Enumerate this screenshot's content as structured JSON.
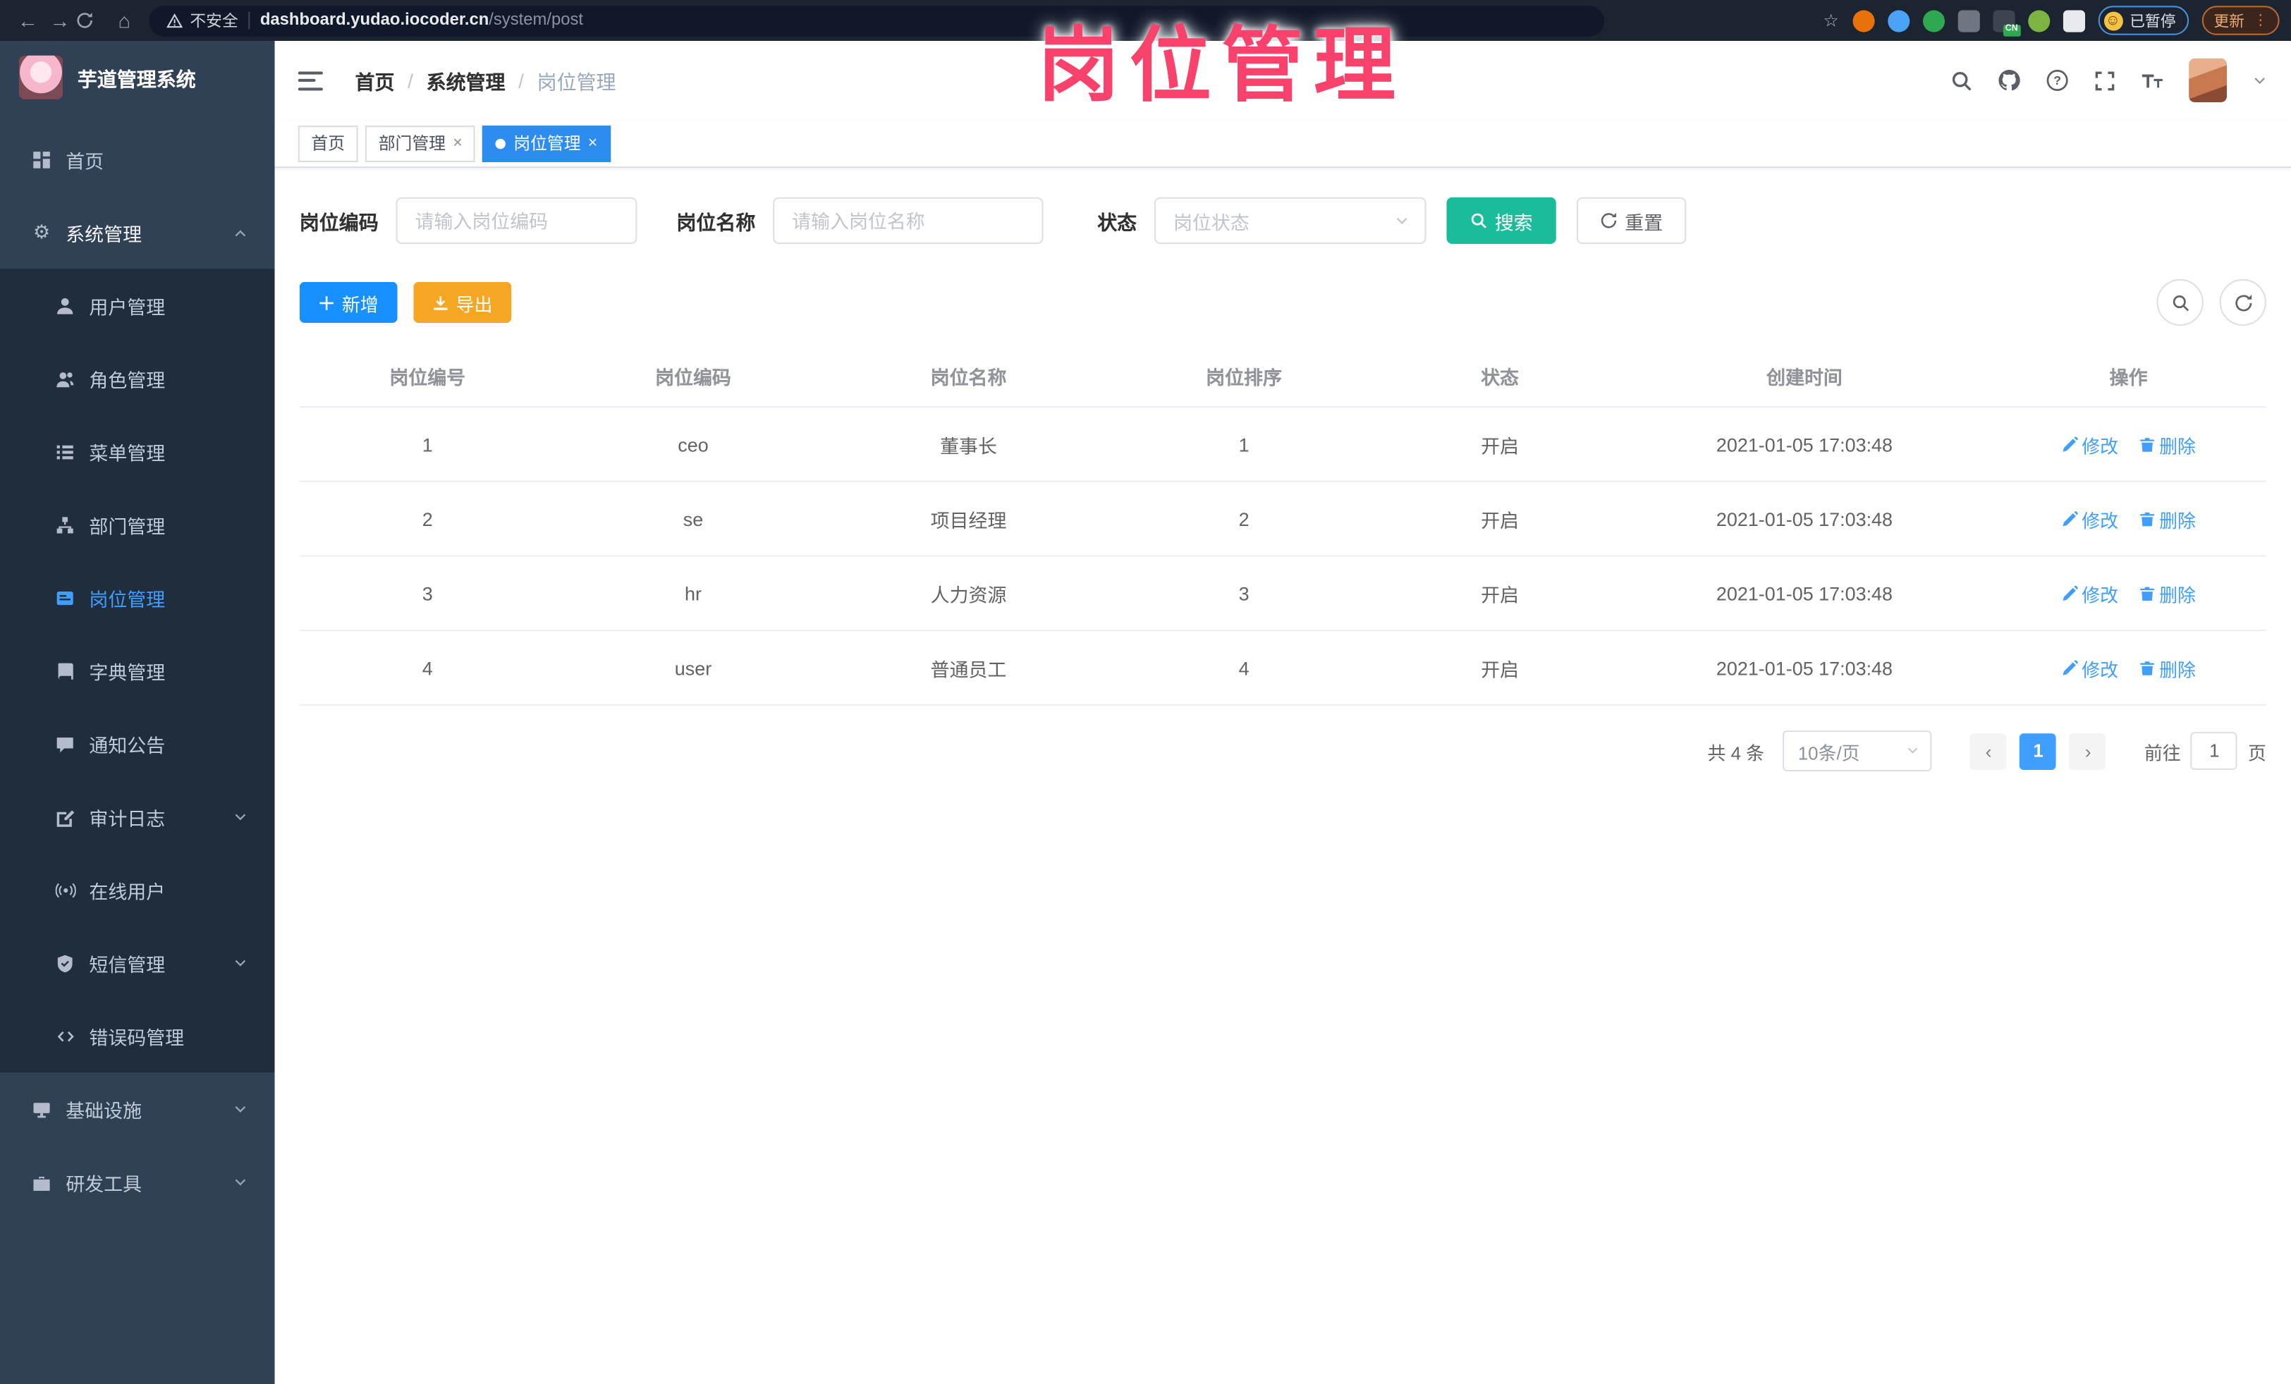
{
  "browser": {
    "back_icon": "←",
    "forward_icon": "→",
    "home_icon": "⌂",
    "security_label": "不安全",
    "url_domain": "dashboard.yudao.iocoder.cn",
    "url_path": "/system/post",
    "bookmark_star": "☆",
    "extensions": [
      {
        "name": "ext-orange-icon",
        "color": "#e8710a",
        "shape": "circle"
      },
      {
        "name": "ext-pin-icon",
        "color": "#4aa3f5",
        "shape": "circle"
      },
      {
        "name": "ext-green-check-icon",
        "color": "#2fa84f",
        "shape": "circle"
      },
      {
        "name": "ext-grid-icon",
        "color": "#6f7681",
        "shape": "square"
      },
      {
        "name": "ext-translate-icon",
        "color": "#3d4450",
        "shape": "square",
        "badge": "CN"
      },
      {
        "name": "ext-leaf-icon",
        "color": "#7cb342",
        "shape": "circle"
      },
      {
        "name": "ext-puzzle-icon",
        "color": "#e8eaed",
        "shape": "square"
      }
    ],
    "paused_label": "已暂停",
    "face_glyph": "☺",
    "update_label": "更新",
    "menu_dots": "⋮"
  },
  "annotation": {
    "text": "岗位管理",
    "color": "#f8426b"
  },
  "sidebar": {
    "title": "芋道管理系统",
    "items": [
      {
        "label": "首页",
        "icon": "dashboard-icon",
        "level": 1
      },
      {
        "label": "系统管理",
        "icon": "gear-icon",
        "level": 1,
        "arrow": "up",
        "open": true
      },
      {
        "label": "用户管理",
        "icon": "user-icon",
        "level": 2
      },
      {
        "label": "角色管理",
        "icon": "role-icon",
        "level": 2
      },
      {
        "label": "菜单管理",
        "icon": "menu-list-icon",
        "level": 2
      },
      {
        "label": "部门管理",
        "icon": "dept-tree-icon",
        "level": 2
      },
      {
        "label": "岗位管理",
        "icon": "post-icon",
        "level": 2,
        "active": true
      },
      {
        "label": "字典管理",
        "icon": "dict-book-icon",
        "level": 2
      },
      {
        "label": "通知公告",
        "icon": "notice-icon",
        "level": 2
      },
      {
        "label": "审计日志",
        "icon": "log-icon",
        "level": 2,
        "arrow": "down"
      },
      {
        "label": "在线用户",
        "icon": "online-icon",
        "level": 2
      },
      {
        "label": "短信管理",
        "icon": "sms-icon",
        "level": 2,
        "arrow": "down"
      },
      {
        "label": "错误码管理",
        "icon": "errorcode-icon",
        "level": 2
      },
      {
        "label": "基础设施",
        "icon": "infra-icon",
        "level": 1,
        "arrow": "down"
      },
      {
        "label": "研发工具",
        "icon": "devtool-icon",
        "level": 1,
        "arrow": "down"
      }
    ]
  },
  "header": {
    "breadcrumb": [
      "首页",
      "系统管理",
      "岗位管理"
    ]
  },
  "tabs": [
    {
      "label": "首页",
      "closable": false,
      "active": false
    },
    {
      "label": "部门管理",
      "closable": true,
      "active": false
    },
    {
      "label": "岗位管理",
      "closable": true,
      "active": true
    }
  ],
  "filters": {
    "fields": [
      {
        "label": "岗位编码",
        "placeholder": "请输入岗位编码"
      },
      {
        "label": "岗位名称",
        "placeholder": "请输入岗位名称"
      },
      {
        "label": "状态",
        "placeholder": "岗位状态"
      }
    ],
    "search_label": "搜索",
    "reset_label": "重置"
  },
  "toolbar": {
    "add_label": "新增",
    "export_label": "导出"
  },
  "table": {
    "headers": [
      "岗位编号",
      "岗位编码",
      "岗位名称",
      "岗位排序",
      "状态",
      "创建时间",
      "操作"
    ],
    "rows": [
      {
        "id": "1",
        "code": "ceo",
        "name": "董事长",
        "sort": "1",
        "status": "开启",
        "created": "2021-01-05 17:03:48"
      },
      {
        "id": "2",
        "code": "se",
        "name": "项目经理",
        "sort": "2",
        "status": "开启",
        "created": "2021-01-05 17:03:48"
      },
      {
        "id": "3",
        "code": "hr",
        "name": "人力资源",
        "sort": "3",
        "status": "开启",
        "created": "2021-01-05 17:03:48"
      },
      {
        "id": "4",
        "code": "user",
        "name": "普通员工",
        "sort": "4",
        "status": "开启",
        "created": "2021-01-05 17:03:48"
      }
    ],
    "edit_label": "修改",
    "delete_label": "删除"
  },
  "pagination": {
    "total_label": "共 4 条",
    "page_size": "10条/页",
    "prev_icon": "‹",
    "next_icon": "›",
    "current_page": "1",
    "goto_label": "前往",
    "goto_value": "1",
    "page_label": "页"
  },
  "colors": {
    "accent_blue": "#409eff",
    "active_tab": "#2d8cf0",
    "search_teal": "#1abc9c",
    "add_blue": "#1890ff",
    "export_orange": "#f5a623",
    "sidebar_bg": "#304156",
    "submenu_bg": "#1f2d3d",
    "annotation_pink": "#f8426b"
  }
}
